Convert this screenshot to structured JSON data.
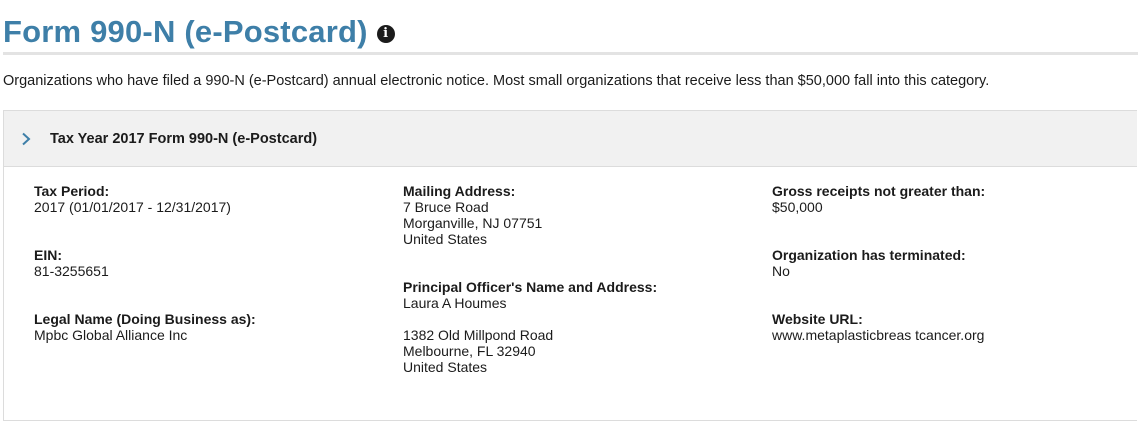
{
  "header": {
    "title": "Form 990-N (e-Postcard)",
    "info_icon": "info-circle-icon"
  },
  "description": "Organizations who have filed a 990-N (e-Postcard) annual electronic notice. Most small organizations that receive less than $50,000 fall into this category.",
  "panel": {
    "title": "Tax Year 2017 Form 990-N (e-Postcard)",
    "chevron_icon": "chevron-right-icon",
    "accent_color": "#3e7fa8"
  },
  "fields": {
    "tax_period": {
      "label": "Tax Period:",
      "value": "2017 (01/01/2017 - 12/31/2017)"
    },
    "ein": {
      "label": "EIN:",
      "value": "81-3255651"
    },
    "legal_name": {
      "label": "Legal Name (Doing Business as):",
      "value": "Mpbc Global Alliance Inc"
    },
    "mailing_address": {
      "label": "Mailing Address:",
      "line1": "7 Bruce Road",
      "line2": "Morganville, NJ 07751",
      "line3": "United States"
    },
    "principal_officer": {
      "label": "Principal Officer's Name and Address:",
      "name": "Laura A Houmes",
      "line1": "1382 Old Millpond Road",
      "line2": "Melbourne, FL 32940",
      "line3": "United States"
    },
    "gross_receipts": {
      "label": "Gross receipts not greater than:",
      "value": "$50,000"
    },
    "terminated": {
      "label": "Organization has terminated:",
      "value": "No"
    },
    "website": {
      "label": "Website URL:",
      "value": "www.metaplasticbreas tcancer.org"
    }
  }
}
